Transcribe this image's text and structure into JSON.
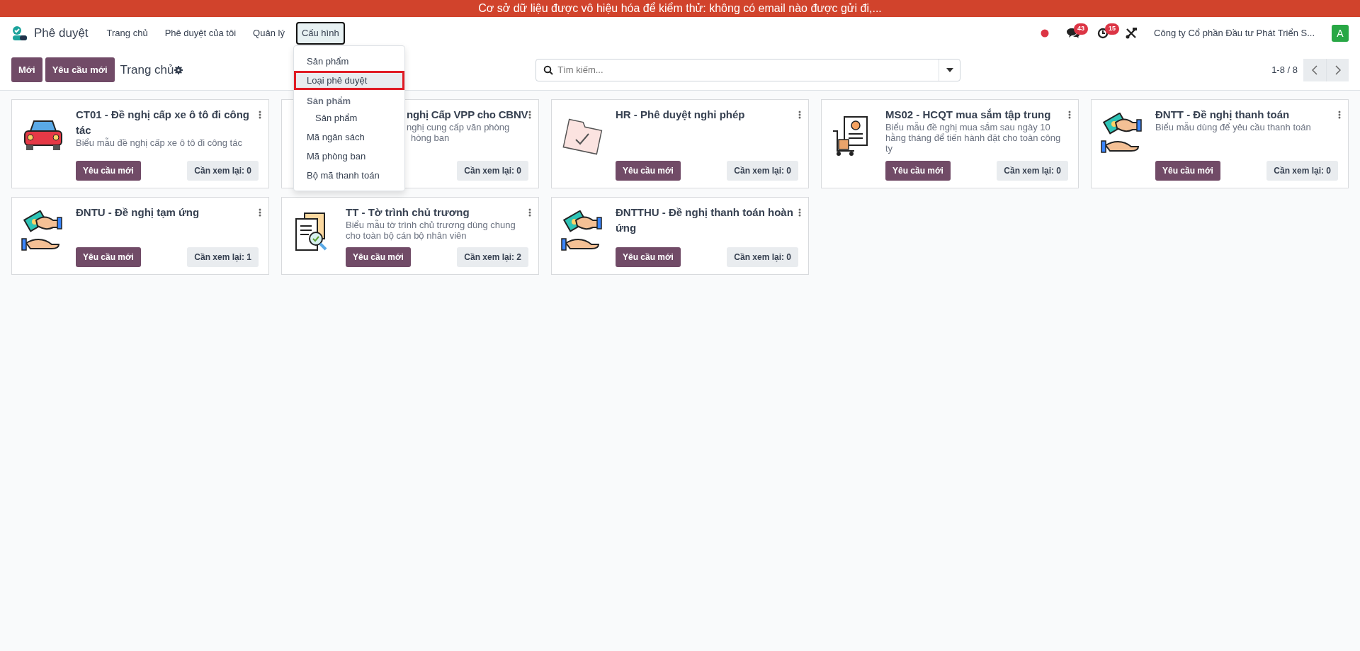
{
  "banner": {
    "text": "Cơ sở dữ liệu được vô hiệu hóa để kiểm thử: không có email nào được gửi đi,..."
  },
  "navbar": {
    "app_name": "Phê duyệt",
    "menu": [
      {
        "label": "Trang chủ",
        "open": false
      },
      {
        "label": "Phê duyệt của tôi",
        "open": false
      },
      {
        "label": "Quản lý",
        "open": false
      },
      {
        "label": "Cấu hình",
        "open": true
      }
    ],
    "messages_badge": "43",
    "activities_badge": "15",
    "company": "Công ty Cổ phần Đầu tư Phát Triển S...",
    "avatar": "A"
  },
  "dropdown": [
    {
      "kind": "item",
      "label": "Sản phẩm",
      "selected": false
    },
    {
      "kind": "item",
      "label": "Loại phê duyệt",
      "selected": true
    },
    {
      "kind": "header",
      "label": "Sản phẩm"
    },
    {
      "kind": "subitem",
      "label": "Sản phẩm",
      "selected": false
    },
    {
      "kind": "item",
      "label": "Mã ngân sách",
      "selected": false
    },
    {
      "kind": "item",
      "label": "Mã phòng ban",
      "selected": false
    },
    {
      "kind": "item",
      "label": "Bộ mã thanh toán",
      "selected": false
    }
  ],
  "control_panel": {
    "buttons": [
      "Mới",
      "Yêu cầu mới"
    ],
    "breadcrumb": "Trang chủ",
    "search_placeholder": "Tìm kiếm...",
    "pager": "1-8 / 8"
  },
  "cards": [
    {
      "title": "CT01 - Đề nghị cấp xe ô tô đi công tác",
      "description": "Biểu mẫu đề nghị cấp xe ô tô đi công tác",
      "button": "Yêu cầu mới",
      "review": "Cần xem lại: 0"
    },
    {
      "title": "nghị Cấp VPP cho CBNV",
      "description_lines": [
        "nghị cung cấp văn phòng",
        "hòng ban"
      ],
      "review": "Cần xem lại: 0",
      "covered": true
    },
    {
      "title": "HR - Phê duyệt nghỉ phép",
      "button": "Yêu cầu mới",
      "review": "Cần xem lại: 0",
      "covered": false
    },
    {
      "title": "MS02 - HCQT mua sắm tập trung",
      "description": "Biểu mẫu đề nghị mua sắm sau ngày 10 hằng tháng để tiến hành đặt cho toàn công ty",
      "button": "Yêu cầu mới",
      "review": "Cần xem lại: 0",
      "covered": false
    },
    {
      "title": "ĐNTT - Đề nghị thanh toán",
      "description": "Biểu mẫu dùng để yêu cầu thanh toán",
      "button": "Yêu cầu mới",
      "review": "Cần xem lại: 0",
      "covered": false
    },
    {
      "title": "ĐNTU - Đề nghị tạm ứng",
      "button": "Yêu cầu mới",
      "review": "Cần xem lại: 1",
      "covered": false
    },
    {
      "title": "TT - Tờ trình chủ trương",
      "description": "Biểu mẫu tờ trình chủ trương dùng chung cho toàn bộ cán bộ nhân viên",
      "button": "Yêu cầu mới",
      "review": "Cần xem lại: 2",
      "covered": false
    },
    {
      "title": "ĐNTTHU - Đề nghị thanh toán hoàn ứng",
      "button": "Yêu cầu mới",
      "review": "Cần xem lại: 0",
      "covered": false
    }
  ]
}
